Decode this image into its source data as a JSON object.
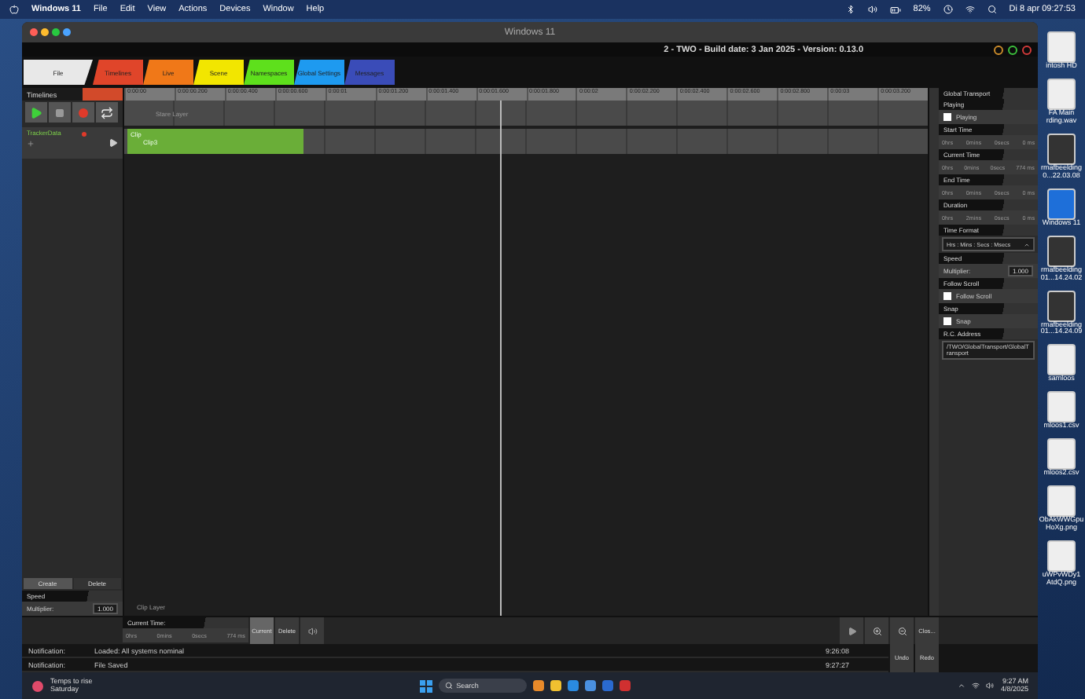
{
  "menubar": {
    "app": "Windows 11",
    "menus": [
      "File",
      "Edit",
      "View",
      "Actions",
      "Devices",
      "Window",
      "Help"
    ],
    "battery": "82%",
    "clock": "Di 8 apr  09:27:53"
  },
  "window": {
    "title": "Windows 11"
  },
  "app": {
    "title": "2 - TWO - Build date: 3 Jan 2025 - Version: 0.13.0"
  },
  "tabs": [
    {
      "label": "File",
      "color": "#e8e8e8",
      "selected": true
    },
    {
      "label": "Timelines",
      "color": "#e0452a",
      "selected": false
    },
    {
      "label": "Live",
      "color": "#f07818",
      "selected": false
    },
    {
      "label": "Scene",
      "color": "#f2e600",
      "selected": false
    },
    {
      "label": "Namespaces",
      "color": "#5ee01c",
      "selected": false
    },
    {
      "label": "Global Settings",
      "color": "#1e9af0",
      "selected": false
    },
    {
      "label": "Messages",
      "color": "#3a4cb8",
      "selected": false
    }
  ],
  "sidebar": {
    "title": "Timelines",
    "transport": [
      {
        "kind": "play"
      },
      {
        "kind": "stop"
      },
      {
        "kind": "record"
      },
      {
        "kind": "loop"
      }
    ],
    "tracks": [
      {
        "name": "TrackerData",
        "armed": true
      }
    ],
    "buttons": [
      "Create",
      "Delete"
    ],
    "speed": {
      "title": "Speed",
      "label": "Multiplier:",
      "value": "1.000"
    }
  },
  "timeline": {
    "ruler": [
      "0:00:00",
      "0:00:00.200",
      "0:00:00.400",
      "0:00:00.600",
      "0:00:01",
      "0:00:01.200",
      "0:00:01.400",
      "0:00:01.600",
      "0:00:01.800",
      "0:00:02",
      "0:00:02.200",
      "0:00:02.400",
      "0:00:02.600",
      "0:00:02.800",
      "0:00:03",
      "0:00:03.200"
    ],
    "layer": "Stare Layer",
    "clip": {
      "label": "Clip",
      "name": "Clip3"
    },
    "footer": "Clip Layer"
  },
  "inspector": {
    "title": "Global Transport",
    "sections": [
      {
        "title": "Playing",
        "kind": "toggle",
        "label": "Playing",
        "checked": true
      },
      {
        "title": "Start Time",
        "kind": "time",
        "parts": [
          "0hrs",
          "0mins",
          "0secs",
          "0 ms"
        ]
      },
      {
        "title": "Current Time",
        "kind": "time",
        "parts": [
          "0hrs",
          "0mins",
          "0secs",
          "774 ms"
        ]
      },
      {
        "title": "End Time",
        "kind": "time",
        "parts": [
          "0hrs",
          "0mins",
          "0secs",
          "0 ms"
        ]
      },
      {
        "title": "Duration",
        "kind": "time",
        "parts": [
          "0hrs",
          "2mins",
          "0secs",
          "0 ms"
        ]
      },
      {
        "title": "Time Format",
        "kind": "select",
        "value": "Hrs : Mins : Secs : Msecs"
      },
      {
        "title": "Speed",
        "kind": "number",
        "label": "Multiplier:",
        "value": "1.000"
      },
      {
        "title": "Follow Scroll",
        "kind": "toggle",
        "label": "Follow Scroll",
        "checked": true
      },
      {
        "title": "Snap",
        "kind": "toggle",
        "label": "Snap",
        "checked": true
      },
      {
        "title": "R.C. Address",
        "kind": "text",
        "value": "/TWO/GlobalTransport/GlobalTransport"
      }
    ]
  },
  "bottom": {
    "title": "Current Time:",
    "parts": [
      "0hrs",
      "0mins",
      "0secs",
      "774 ms"
    ],
    "buttons": [
      "Current",
      "Delete"
    ],
    "close": "Clos..."
  },
  "notifications": [
    {
      "label": "Notification:",
      "text": "Loaded: All systems nominal",
      "time": "9:26:08"
    },
    {
      "label": "Notification:",
      "text": "File Saved",
      "time": "9:27:27"
    }
  ],
  "history": [
    "Undo",
    "Redo"
  ],
  "taskbar": {
    "weather": "Temps to rise",
    "day": "Saturday",
    "search": "Search",
    "time": "9:27 AM",
    "date": "4/8/2025"
  },
  "desktop": [
    {
      "kind": "drive",
      "label": "intosh HD"
    },
    {
      "kind": "file",
      "label": "FA Main\nrding.wav"
    },
    {
      "kind": "image",
      "label": "rmafbeelding\n0...22.03.08"
    },
    {
      "kind": "vm",
      "label": "Windows 11"
    },
    {
      "kind": "image",
      "label": "rmafbeelding\n01...14.24.02"
    },
    {
      "kind": "image",
      "label": "rmafbeelding\n01...14.24.09"
    },
    {
      "kind": "file",
      "label": "samloos"
    },
    {
      "kind": "file",
      "label": "mloos1.csv"
    },
    {
      "kind": "file",
      "label": "mloos2.csv"
    },
    {
      "kind": "file",
      "label": "ObAkWWGpu\nHoXg.png"
    },
    {
      "kind": "file",
      "label": "uWPvWDy1\nAtdQ.png"
    }
  ]
}
